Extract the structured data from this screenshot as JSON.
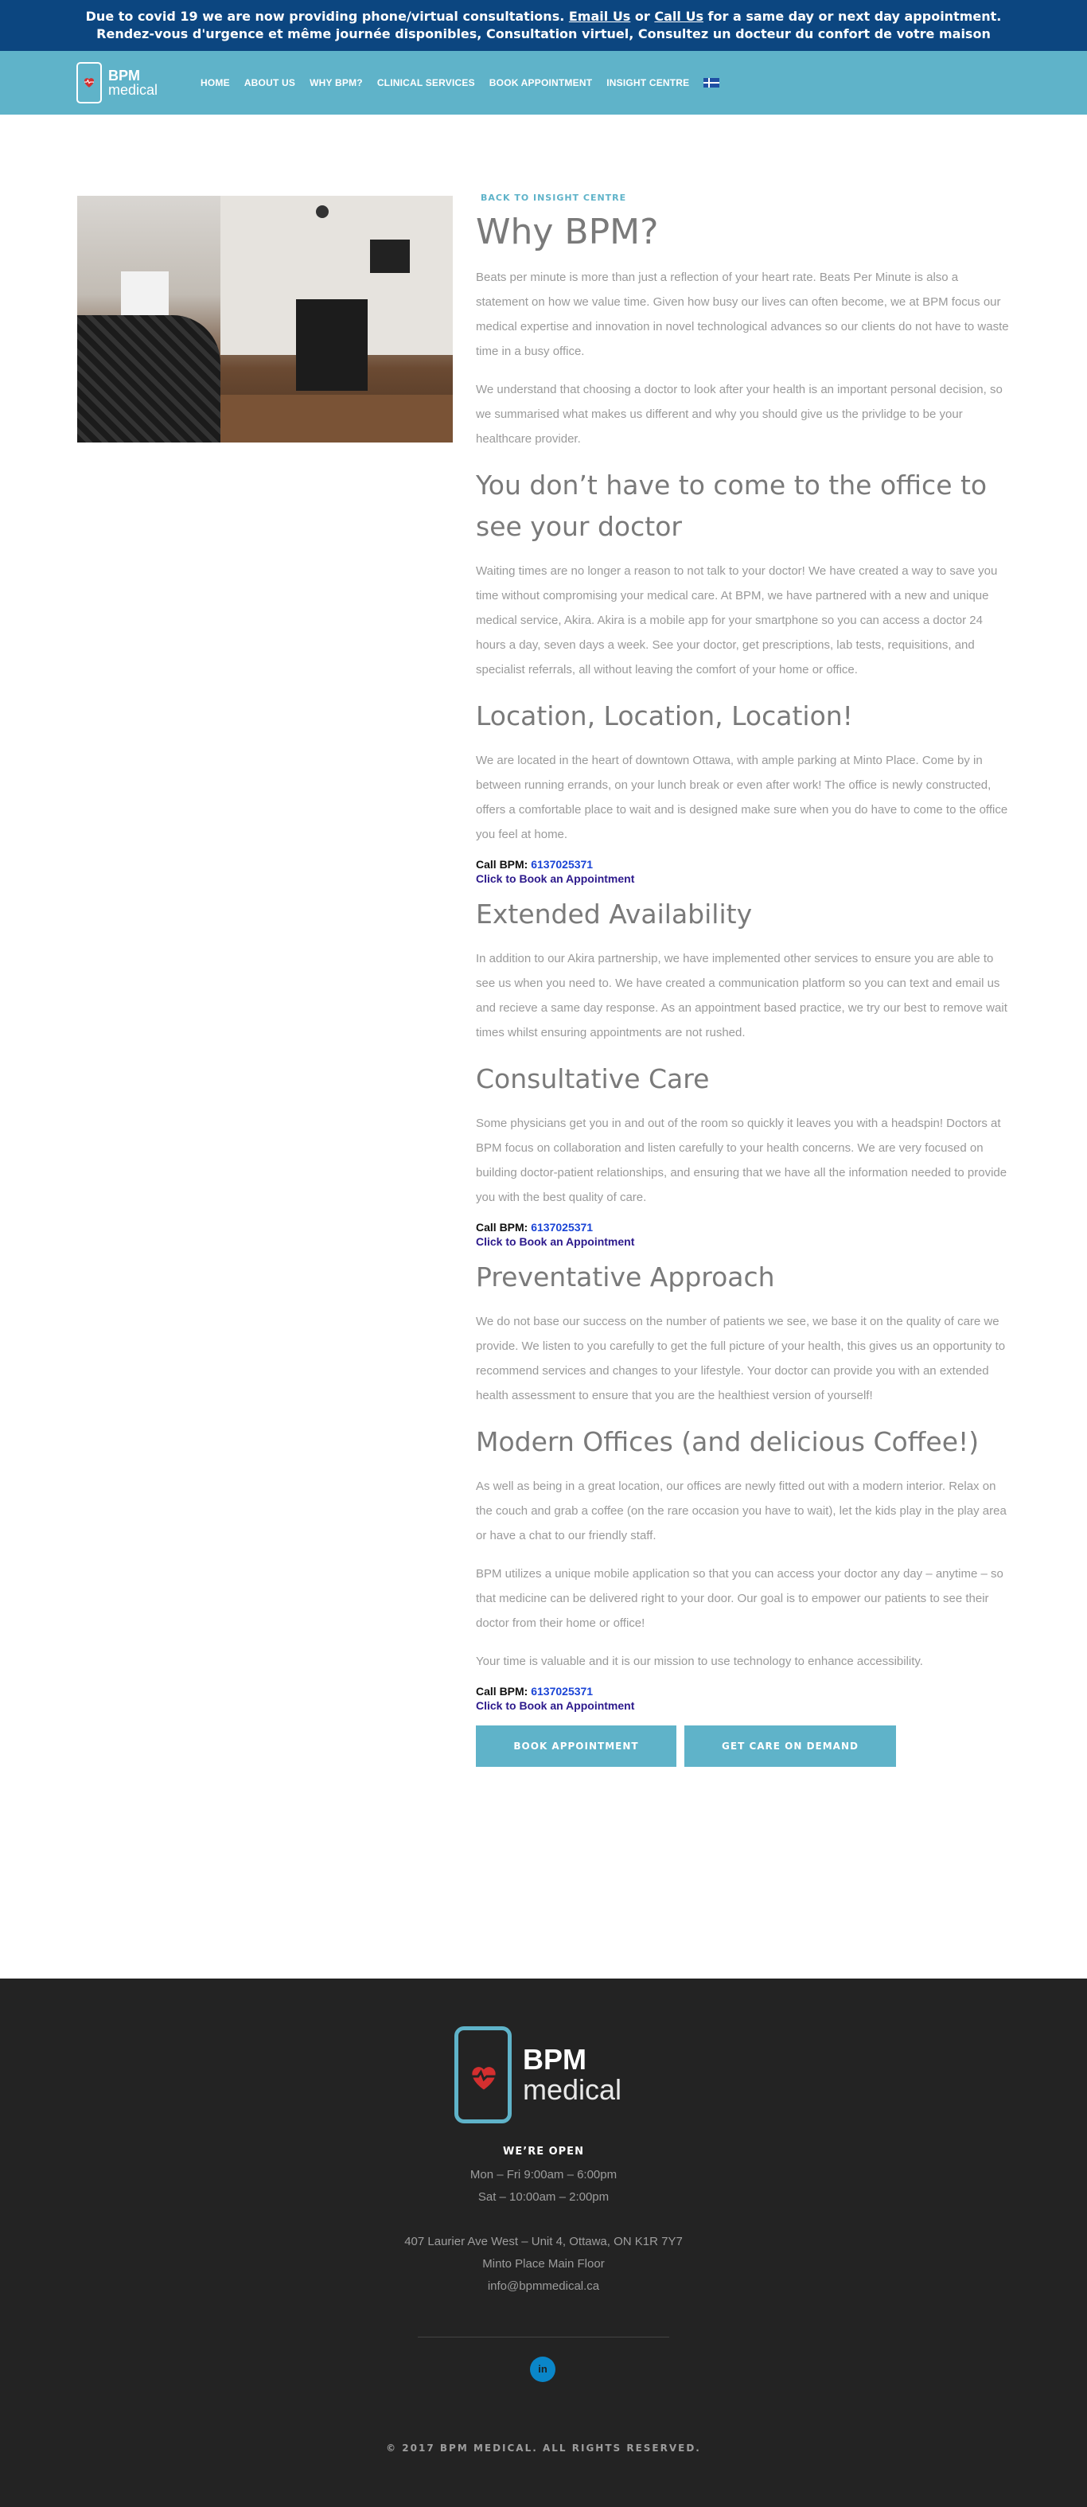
{
  "notice": {
    "line1_a": "Due to covid 19 we are now providing phone/virtual consultations.",
    "email_link": "Email Us",
    "or_text": "or",
    "call_link": "Call Us",
    "line1_b": "for a same day or next day appointment.",
    "line2": "Rendez-vous d'urgence et même journée disponibles, Consultation virtuel, Consultez un docteur du confort de votre maison"
  },
  "brand": {
    "name": "BPM",
    "sub": "medical"
  },
  "nav": {
    "items": [
      "HOME",
      "ABOUT US",
      "WHY BPM?",
      "CLINICAL SERVICES",
      "BOOK APPOINTMENT",
      "INSIGHT CENTRE"
    ]
  },
  "content": {
    "back_label": "BACK TO INSIGHT CENTRE",
    "title": "Why BPM?",
    "intro1": "Beats per minute is more than just a reflection of your heart rate. Beats Per Minute is also a statement on how we value time. Given how busy our lives can often become, we at BPM focus our medical expertise and innovation in novel technological advances so our clients do not have to waste time in a busy office.",
    "intro2": "We understand that choosing a doctor to look after your health is an important personal decision, so we summarised what makes us different and why you should give us the privlidge to be your healthcare provider.",
    "s1_title": "You don’t have to come to the office to see your doctor",
    "s1_body": "Waiting times are no longer a reason to not talk to your doctor! We have created a way to save you time without compromising your medical care. At BPM, we have partnered with a new and unique medical service, Akira. Akira is a mobile app for your smartphone so you can access a doctor 24 hours a day, seven days a week. See your doctor, get prescriptions, lab tests, requisitions, and specialist referrals, all without leaving the comfort of your home or office.",
    "s2_title": "Location, Location, Location!",
    "s2_body": "We are located in the heart of downtown Ottawa, with ample parking at Minto Place. Come by in between running errands, on your lunch break or even after work! The office is newly constructed, offers a comfortable place to wait and is designed make sure when you do have to come to the office you feel at home.",
    "call_label": "Call BPM:",
    "call_number": "6137025371",
    "book_link": "Click to Book an Appointment",
    "s3_title": "Extended Availability",
    "s3_body": "In addition to our Akira partnership, we have implemented other services to ensure you are able to see us when you need to. We have created a communication platform so you can text and email us and recieve a same day response.  As an appointment based practice, we try our best to remove wait times whilst ensuring appointments are not rushed.",
    "s4_title": "Consultative Care",
    "s4_body": "Some physicians get you in and out of the room so quickly it leaves you with a headspin! Doctors at BPM focus on collaboration and listen carefully to your health concerns. We are very focused on building doctor-patient relationships, and ensuring that we have all the information needed to provide you with the best quality of care.",
    "s5_title": "Preventative Approach",
    "s5_body": "We do not base our success on the number of patients we see, we base it on the quality of care we provide. We listen to you carefully to get the full picture of your health, this gives us an opportunity to recommend services and changes to your lifestyle. Your doctor can provide you with an extended health assessment to ensure that you are the healthiest version of yourself!",
    "s6_title": "Modern Offices (and delicious Coffee!)",
    "s6_body1": "As well as being in a great location, our offices are newly fitted out with a modern interior. Relax on the couch and grab a coffee (on the rare occasion you have to wait), let the kids play in the play area or have a chat to our friendly staff.",
    "s6_body2": "BPM utilizes a unique mobile application so that you can access your doctor any day – anytime – so that medicine can be delivered right to your door. Our goal is to empower our patients to see their doctor from their home or office!",
    "s6_body3": "Your time is valuable and it is our mission to use technology to enhance accessibility.",
    "cta_book": "BOOK APPOINTMENT",
    "cta_care": "GET CARE ON DEMAND"
  },
  "footer": {
    "open_title": "WE’RE OPEN",
    "hours1": "Mon – Fri 9:00am – 6:00pm",
    "hours2": "Sat – 10:00am – 2:00pm",
    "address": "407 Laurier Ave West – Unit 4, Ottawa, ON K1R 7Y7",
    "place": "Minto Place Main Floor",
    "email": "info@bpmmedical.ca",
    "linkedin": "in",
    "copyright": "© 2017 BPM MEDICAL. ALL RIGHTS RESERVED."
  },
  "colors": {
    "notice_bg": "#0c4680",
    "brand": "#5fb3c9",
    "footer_bg": "#232323",
    "heart": "#d32f2f"
  }
}
